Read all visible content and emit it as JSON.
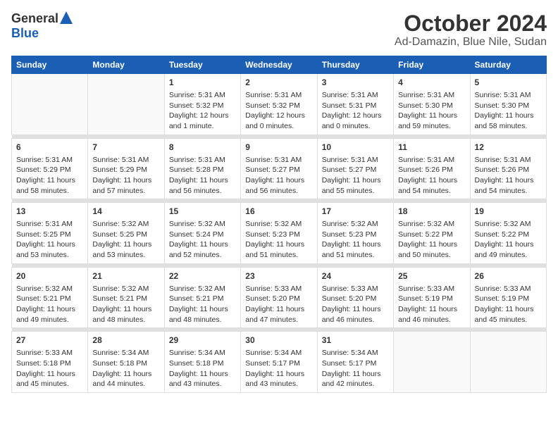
{
  "logo": {
    "general": "General",
    "blue": "Blue"
  },
  "title": "October 2024",
  "subtitle": "Ad-Damazin, Blue Nile, Sudan",
  "headers": [
    "Sunday",
    "Monday",
    "Tuesday",
    "Wednesday",
    "Thursday",
    "Friday",
    "Saturday"
  ],
  "weeks": [
    [
      {
        "day": "",
        "info": ""
      },
      {
        "day": "",
        "info": ""
      },
      {
        "day": "1",
        "info": "Sunrise: 5:31 AM\nSunset: 5:32 PM\nDaylight: 12 hours and 1 minute."
      },
      {
        "day": "2",
        "info": "Sunrise: 5:31 AM\nSunset: 5:32 PM\nDaylight: 12 hours and 0 minutes."
      },
      {
        "day": "3",
        "info": "Sunrise: 5:31 AM\nSunset: 5:31 PM\nDaylight: 12 hours and 0 minutes."
      },
      {
        "day": "4",
        "info": "Sunrise: 5:31 AM\nSunset: 5:30 PM\nDaylight: 11 hours and 59 minutes."
      },
      {
        "day": "5",
        "info": "Sunrise: 5:31 AM\nSunset: 5:30 PM\nDaylight: 11 hours and 58 minutes."
      }
    ],
    [
      {
        "day": "6",
        "info": "Sunrise: 5:31 AM\nSunset: 5:29 PM\nDaylight: 11 hours and 58 minutes."
      },
      {
        "day": "7",
        "info": "Sunrise: 5:31 AM\nSunset: 5:29 PM\nDaylight: 11 hours and 57 minutes."
      },
      {
        "day": "8",
        "info": "Sunrise: 5:31 AM\nSunset: 5:28 PM\nDaylight: 11 hours and 56 minutes."
      },
      {
        "day": "9",
        "info": "Sunrise: 5:31 AM\nSunset: 5:27 PM\nDaylight: 11 hours and 56 minutes."
      },
      {
        "day": "10",
        "info": "Sunrise: 5:31 AM\nSunset: 5:27 PM\nDaylight: 11 hours and 55 minutes."
      },
      {
        "day": "11",
        "info": "Sunrise: 5:31 AM\nSunset: 5:26 PM\nDaylight: 11 hours and 54 minutes."
      },
      {
        "day": "12",
        "info": "Sunrise: 5:31 AM\nSunset: 5:26 PM\nDaylight: 11 hours and 54 minutes."
      }
    ],
    [
      {
        "day": "13",
        "info": "Sunrise: 5:31 AM\nSunset: 5:25 PM\nDaylight: 11 hours and 53 minutes."
      },
      {
        "day": "14",
        "info": "Sunrise: 5:32 AM\nSunset: 5:25 PM\nDaylight: 11 hours and 53 minutes."
      },
      {
        "day": "15",
        "info": "Sunrise: 5:32 AM\nSunset: 5:24 PM\nDaylight: 11 hours and 52 minutes."
      },
      {
        "day": "16",
        "info": "Sunrise: 5:32 AM\nSunset: 5:23 PM\nDaylight: 11 hours and 51 minutes."
      },
      {
        "day": "17",
        "info": "Sunrise: 5:32 AM\nSunset: 5:23 PM\nDaylight: 11 hours and 51 minutes."
      },
      {
        "day": "18",
        "info": "Sunrise: 5:32 AM\nSunset: 5:22 PM\nDaylight: 11 hours and 50 minutes."
      },
      {
        "day": "19",
        "info": "Sunrise: 5:32 AM\nSunset: 5:22 PM\nDaylight: 11 hours and 49 minutes."
      }
    ],
    [
      {
        "day": "20",
        "info": "Sunrise: 5:32 AM\nSunset: 5:21 PM\nDaylight: 11 hours and 49 minutes."
      },
      {
        "day": "21",
        "info": "Sunrise: 5:32 AM\nSunset: 5:21 PM\nDaylight: 11 hours and 48 minutes."
      },
      {
        "day": "22",
        "info": "Sunrise: 5:32 AM\nSunset: 5:21 PM\nDaylight: 11 hours and 48 minutes."
      },
      {
        "day": "23",
        "info": "Sunrise: 5:33 AM\nSunset: 5:20 PM\nDaylight: 11 hours and 47 minutes."
      },
      {
        "day": "24",
        "info": "Sunrise: 5:33 AM\nSunset: 5:20 PM\nDaylight: 11 hours and 46 minutes."
      },
      {
        "day": "25",
        "info": "Sunrise: 5:33 AM\nSunset: 5:19 PM\nDaylight: 11 hours and 46 minutes."
      },
      {
        "day": "26",
        "info": "Sunrise: 5:33 AM\nSunset: 5:19 PM\nDaylight: 11 hours and 45 minutes."
      }
    ],
    [
      {
        "day": "27",
        "info": "Sunrise: 5:33 AM\nSunset: 5:18 PM\nDaylight: 11 hours and 45 minutes."
      },
      {
        "day": "28",
        "info": "Sunrise: 5:34 AM\nSunset: 5:18 PM\nDaylight: 11 hours and 44 minutes."
      },
      {
        "day": "29",
        "info": "Sunrise: 5:34 AM\nSunset: 5:18 PM\nDaylight: 11 hours and 43 minutes."
      },
      {
        "day": "30",
        "info": "Sunrise: 5:34 AM\nSunset: 5:17 PM\nDaylight: 11 hours and 43 minutes."
      },
      {
        "day": "31",
        "info": "Sunrise: 5:34 AM\nSunset: 5:17 PM\nDaylight: 11 hours and 42 minutes."
      },
      {
        "day": "",
        "info": ""
      },
      {
        "day": "",
        "info": ""
      }
    ]
  ]
}
